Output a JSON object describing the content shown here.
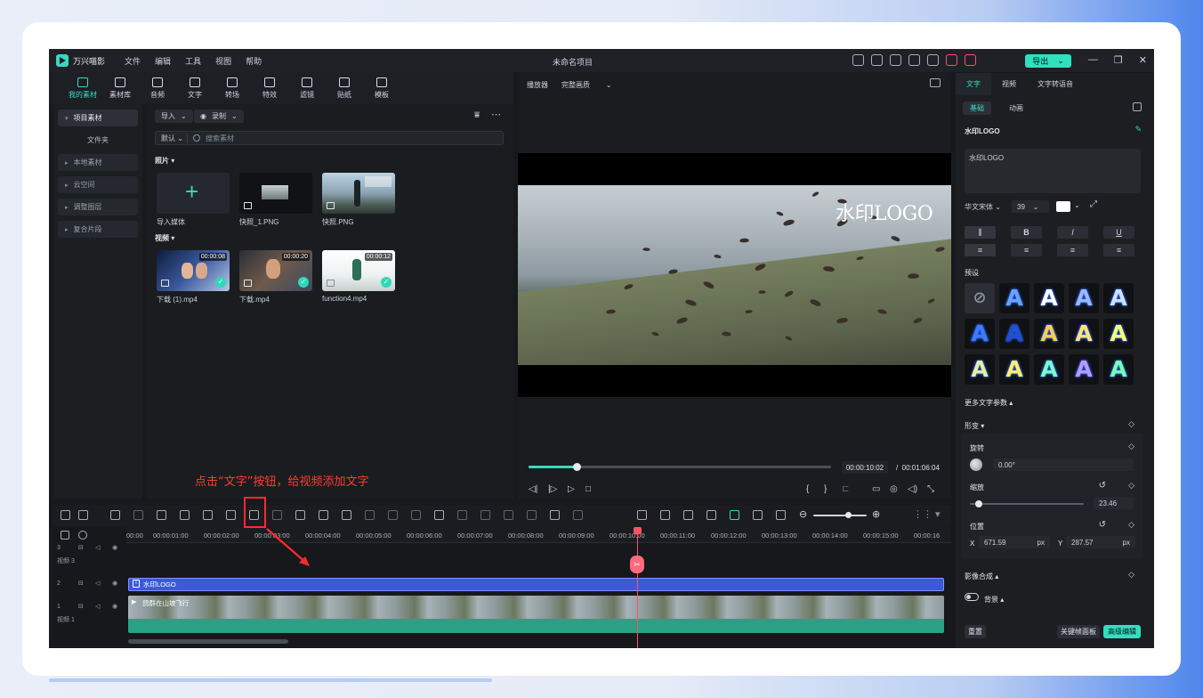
{
  "app": {
    "name": "万兴喵影",
    "document_title": "未命名项目",
    "menu": [
      "文件",
      "编辑",
      "工具",
      "视图",
      "帮助"
    ],
    "export_label": "导出"
  },
  "top_tools": [
    {
      "label": "我的素材",
      "icon": "folder-icon",
      "active": true
    },
    {
      "label": "素材库",
      "icon": "library-icon"
    },
    {
      "label": "音频",
      "icon": "music-icon"
    },
    {
      "label": "文字",
      "icon": "text-icon"
    },
    {
      "label": "转场",
      "icon": "transition-icon"
    },
    {
      "label": "特效",
      "icon": "effects-icon"
    },
    {
      "label": "滤镜",
      "icon": "filter-icon"
    },
    {
      "label": "贴纸",
      "icon": "sticker-icon"
    },
    {
      "label": "模板",
      "icon": "template-icon"
    }
  ],
  "left_nav": {
    "project_media": "项目素材",
    "folder": "文件夹",
    "items": [
      "本地素材",
      "云空间",
      "调整图层",
      "复合片段"
    ]
  },
  "media": {
    "import_label": "导入",
    "record_label": "录制",
    "sort_label": "默认",
    "search_placeholder": "搜索素材",
    "photos_section": "照片",
    "videos_section": "视频",
    "photos": [
      {
        "label": "导入媒体"
      },
      {
        "label": "快照_1.PNG"
      },
      {
        "label": "快照.PNG"
      }
    ],
    "videos": [
      {
        "label": "下载 (1).mp4",
        "duration": "00:00:08"
      },
      {
        "label": "下载.mp4",
        "duration": "00:00:20"
      },
      {
        "label": "function4.mp4",
        "duration": "00:00:12"
      }
    ]
  },
  "player": {
    "label": "播放器",
    "quality": "完整画质",
    "watermark_text": "水印LOGO",
    "current_time": "00:00:10:02",
    "total_time": "00:01:06:04",
    "progress": 0.16
  },
  "right_panel": {
    "tabs": [
      "文字",
      "视频",
      "文字转语音"
    ],
    "subtabs": [
      "基础",
      "动画"
    ],
    "title": "水印LOGO",
    "text_value": "水印LOGO",
    "font": "华文宋体",
    "font_size": "39",
    "format_buttons": [
      "B",
      "I",
      "U"
    ],
    "preset_label": "预设",
    "more_params": "更多文字参数",
    "transform": "形变",
    "rotate_label": "旋转",
    "rotate_value": "0.00°",
    "scale_label": "缩放",
    "scale_value": "23.46",
    "position_label": "位置",
    "pos_x_label": "X",
    "pos_x": "671.59",
    "pos_y_label": "Y",
    "pos_y": "287.57",
    "unit": "px",
    "compositing": "影像合成",
    "background_label": "背景",
    "reset_label": "重置",
    "keyframe_label": "关键帧面板",
    "advanced_label": "高级编辑"
  },
  "timeline": {
    "ruler": [
      "00:00",
      "00:00:01:00",
      "00:00:02:00",
      "00:00:03:00",
      "00:00:04:00",
      "00:00:05:00",
      "00:00:06:00",
      "00:00:07:00",
      "00:00:08:00",
      "00:00:09:00",
      "00:00:10:00",
      "00:00:11:00",
      "00:00:12:00",
      "00:00:13:00",
      "00:00:14:00",
      "00:00:15:00",
      "00:00:16"
    ],
    "tracks": [
      {
        "num": "3",
        "name": "视频 3"
      },
      {
        "num": "2",
        "name": ""
      },
      {
        "num": "1",
        "name": "视频 1"
      }
    ],
    "title_clip": "水印LOGO",
    "video_clip": "鸽群在山坡飞行"
  },
  "annotation": {
    "text": "点击“文字”按钮，给视频添加文字",
    "color": "#ff3b2f"
  },
  "colors": {
    "accent": "#34dcc0",
    "playhead": "#ff5165",
    "title_clip": "#3c5ad8"
  }
}
